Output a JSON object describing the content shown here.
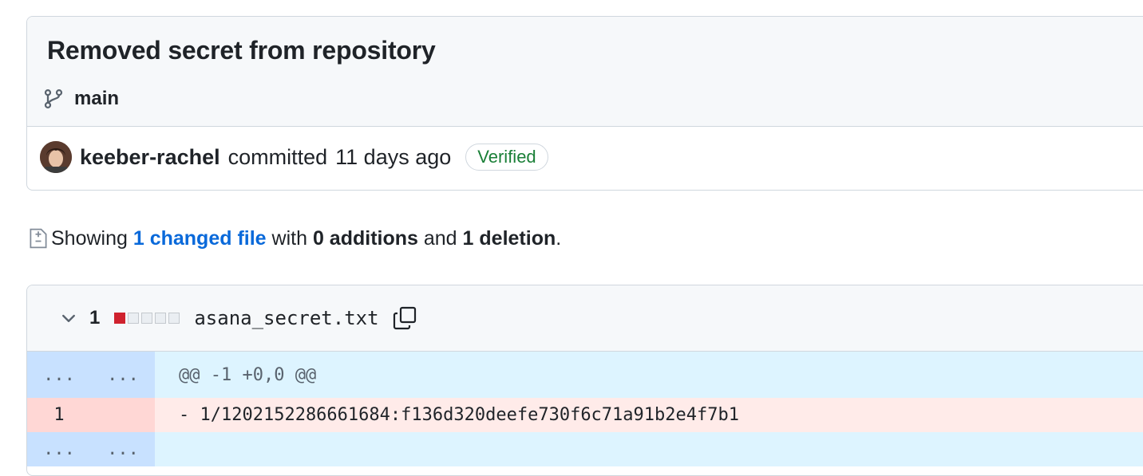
{
  "commit": {
    "title": "Removed secret from repository",
    "branch": "main",
    "author": "keeber-rachel",
    "action": "committed",
    "time": "11 days ago",
    "badge": "Verified"
  },
  "summary": {
    "prefix": "Showing",
    "changed_files": "1 changed file",
    "with_text": "with",
    "additions": "0 additions",
    "and_text": "and",
    "deletions": "1 deletion",
    "suffix": "."
  },
  "diff": {
    "change_count": "1",
    "filename": "asana_secret.txt",
    "rows": {
      "hunk": {
        "old": "...",
        "new": "...",
        "text": "@@ -1 +0,0 @@"
      },
      "deleted": {
        "old": "1",
        "new": "",
        "text": "- 1/1202152286661684:f136d320deefe730f6c71a91b2e4f7b1"
      },
      "expand": {
        "old": "...",
        "new": "...",
        "text": ""
      }
    }
  },
  "colors": {
    "link": "#0969da",
    "verified": "#1a7f37",
    "deletion": "#cf222e",
    "hunk_bg": "#ddf4ff",
    "deleted_bg": "#ffebe9"
  },
  "icons": [
    "git-branch-icon",
    "avatar",
    "diff-icon",
    "chevron-down-icon",
    "copy-icon"
  ]
}
